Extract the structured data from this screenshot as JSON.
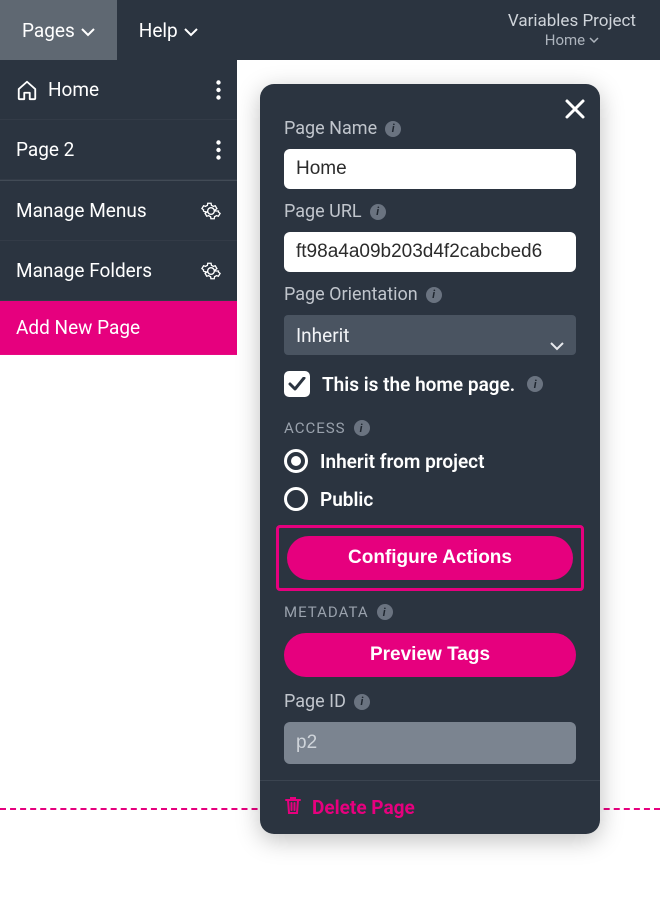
{
  "topbar": {
    "pages_label": "Pages",
    "help_label": "Help",
    "project_title": "Variables Project",
    "project_sub": "Home"
  },
  "sidebar": {
    "items": [
      {
        "label": "Home",
        "icon": "home"
      },
      {
        "label": "Page 2",
        "icon": null
      }
    ],
    "manage_menus_label": "Manage Menus",
    "manage_folders_label": "Manage Folders",
    "add_new_page_label": "Add New Page"
  },
  "panel": {
    "page_name_label": "Page Name",
    "page_name_value": "Home",
    "page_url_label": "Page URL",
    "page_url_value": "ft98a4a09b203d4f2cabcbed6",
    "page_orientation_label": "Page Orientation",
    "page_orientation_value": "Inherit",
    "home_checkbox_label": "This is the home page.",
    "home_checkbox_checked": true,
    "access_header": "ACCESS",
    "access_options": [
      {
        "label": "Inherit from project",
        "checked": true
      },
      {
        "label": "Public",
        "checked": false
      }
    ],
    "configure_actions_label": "Configure Actions",
    "metadata_header": "METADATA",
    "preview_tags_label": "Preview Tags",
    "page_id_label": "Page ID",
    "page_id_value": "p2",
    "delete_page_label": "Delete Page"
  }
}
